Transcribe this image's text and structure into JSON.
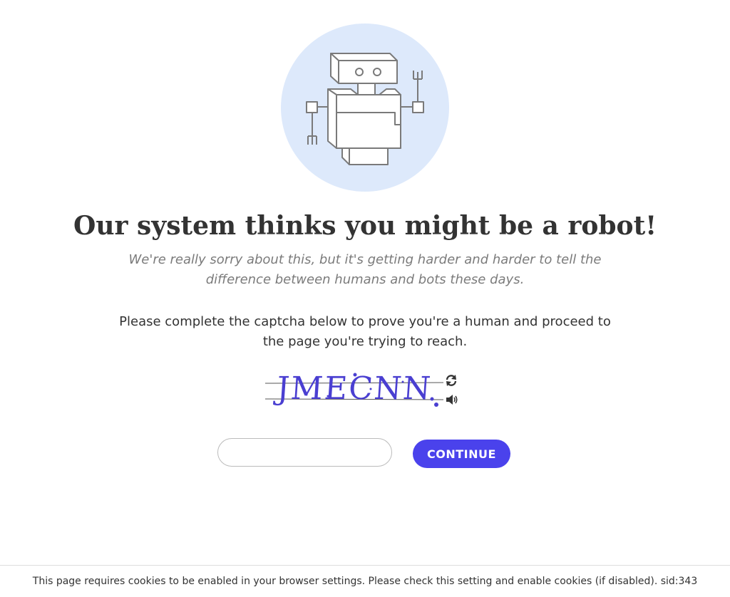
{
  "header": {
    "title": "Our system thinks you might be a robot!",
    "subtitle": "We're really sorry about this, but it's getting harder and harder to tell the difference between humans and bots these days."
  },
  "main": {
    "instructions": "Please complete the captcha below to prove you're a human and proceed to the page you're trying to reach.",
    "captcha": {
      "text": "JMECNN",
      "refresh_icon": "refresh-icon",
      "audio_icon": "speaker-icon",
      "input_value": "",
      "input_placeholder": ""
    },
    "continue_label": "CONTINUE"
  },
  "footer": {
    "text": "This page requires cookies to be enabled in your browser settings. Please check this setting and enable cookies (if disabled). sid:343"
  },
  "colors": {
    "accent": "#4a42ec",
    "illustration_bg": "#dde9fb",
    "captcha_text": "#4a3fd1"
  }
}
